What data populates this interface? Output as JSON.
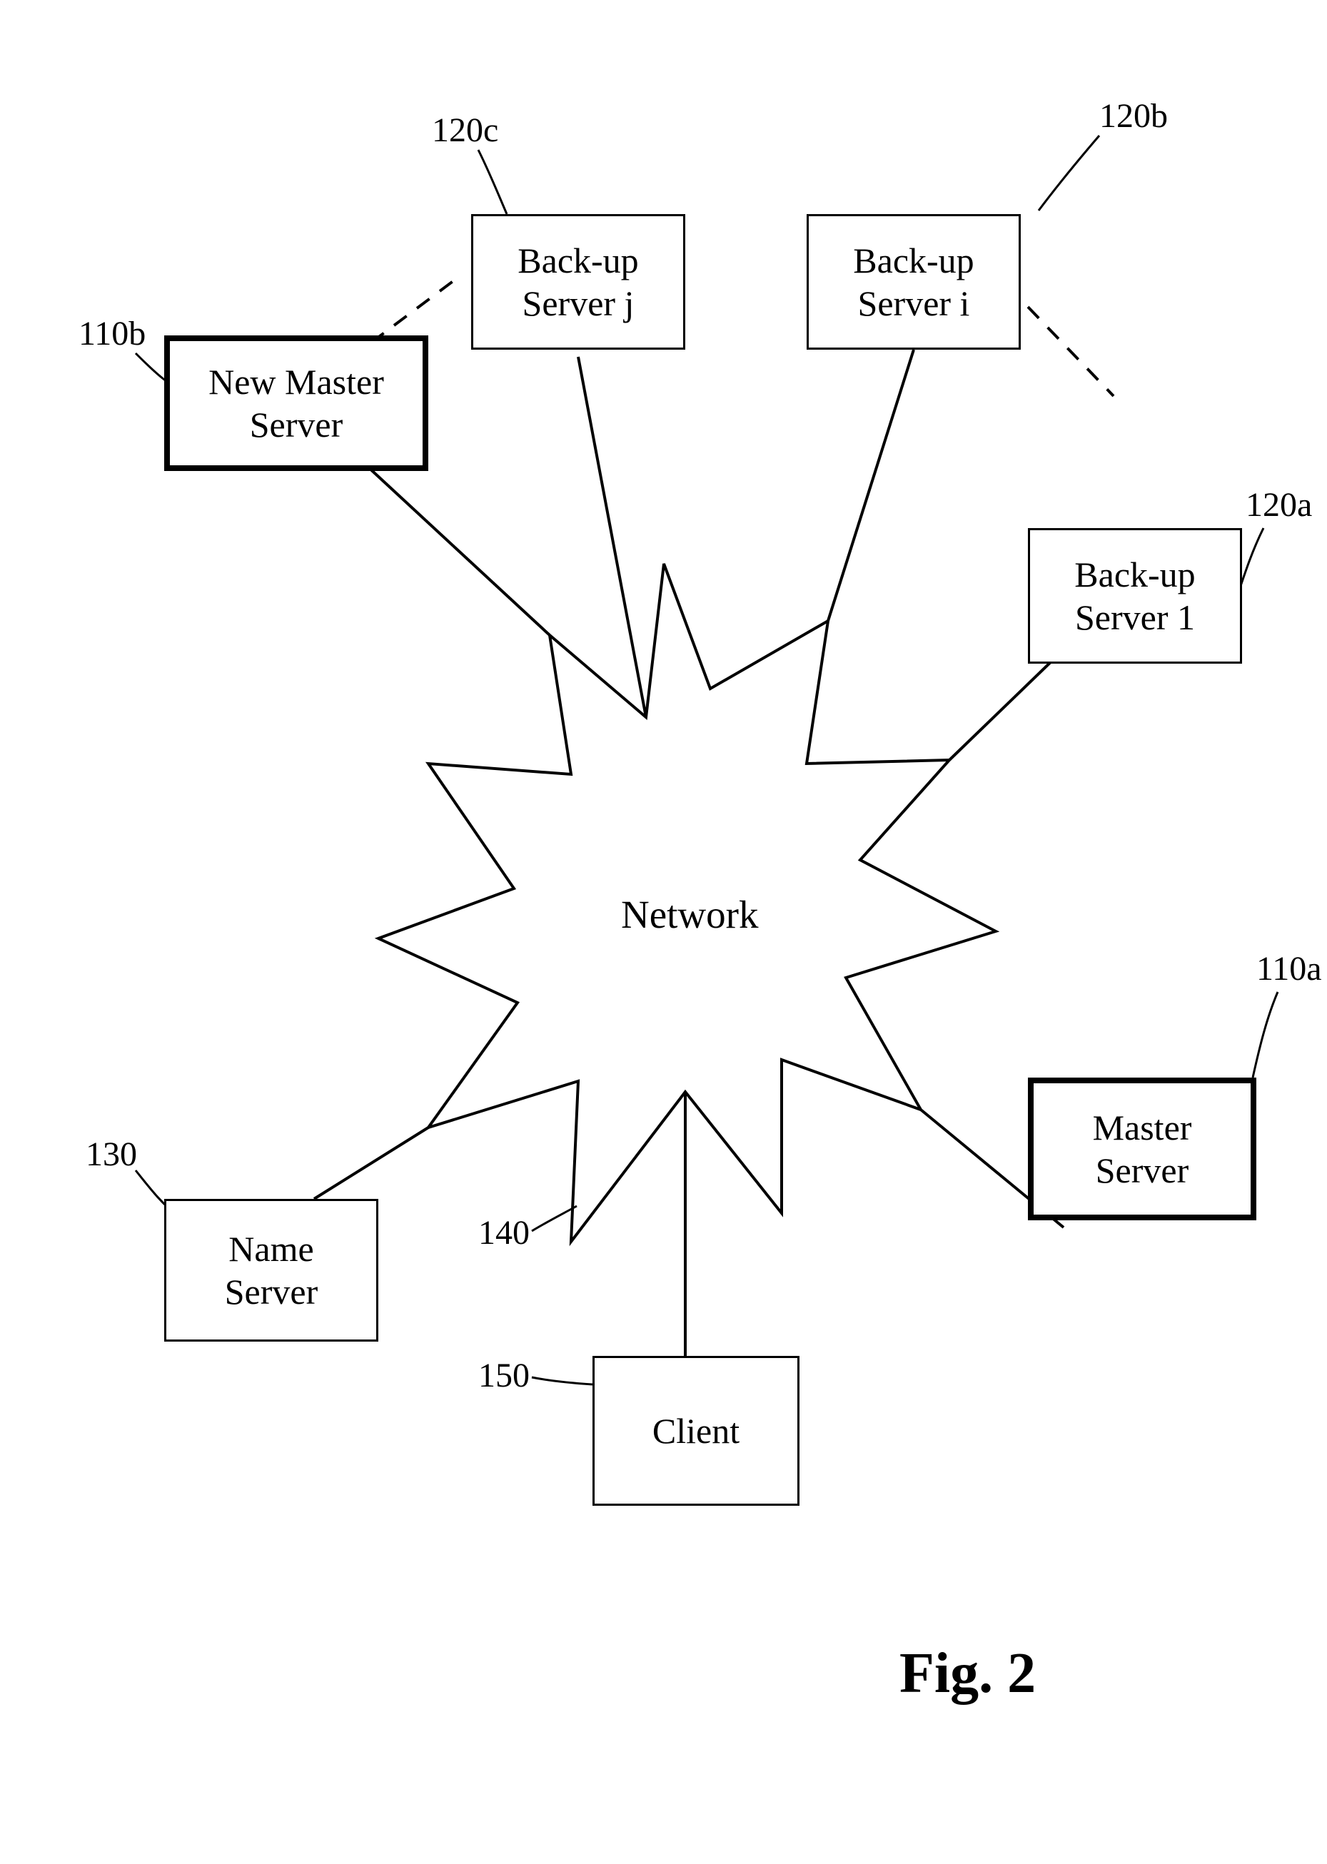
{
  "figure_caption": "Fig. 2",
  "network_label": "Network",
  "nodes": {
    "new_master_server": {
      "label_line1": "New Master",
      "label_line2": "Server",
      "ref": "110b"
    },
    "backup_server_j": {
      "label_line1": "Back-up",
      "label_line2": "Server j",
      "ref": "120c"
    },
    "backup_server_i": {
      "label_line1": "Back-up",
      "label_line2": "Server i",
      "ref": "120b"
    },
    "backup_server_1": {
      "label_line1": "Back-up",
      "label_line2": "Server 1",
      "ref": "120a"
    },
    "master_server": {
      "label_line1": "Master",
      "label_line2": "Server",
      "ref": "110a"
    },
    "name_server": {
      "label_line1": "Name",
      "label_line2": "Server",
      "ref": "130"
    },
    "client": {
      "label_line1": "Client",
      "label_line2": "",
      "ref": "150"
    }
  },
  "refs": {
    "network": "140"
  }
}
